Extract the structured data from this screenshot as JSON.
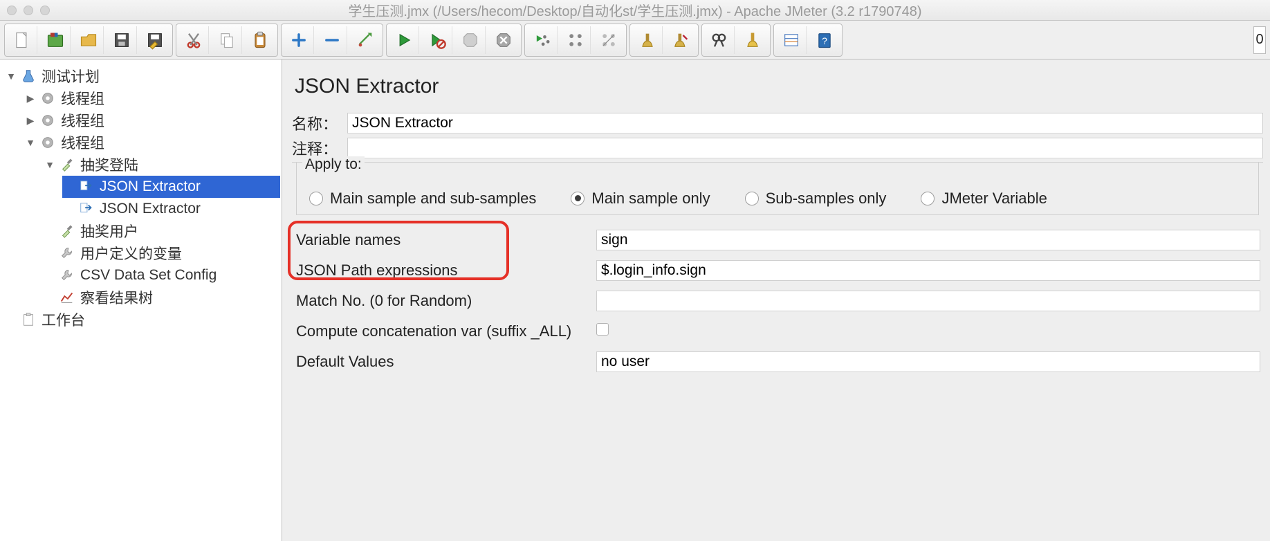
{
  "window": {
    "title": "学生压测.jmx (/Users/hecom/Desktop/自动化st/学生压测.jmx) - Apache JMeter (3.2 r1790748)"
  },
  "tree": {
    "root": "测试计划",
    "thread_1": "线程组",
    "thread_2": "线程组",
    "thread_3": "线程组",
    "lottery_login": "抽奖登陆",
    "json_extractor_1": "JSON Extractor",
    "json_extractor_2": "JSON Extractor",
    "lottery_user": "抽奖用户",
    "user_defined_vars": "用户定义的变量",
    "csv_config": "CSV Data Set Config",
    "view_results_tree": "察看结果树",
    "workbench": "工作台"
  },
  "main": {
    "title": "JSON Extractor",
    "name_label": "名称：",
    "name_value": "JSON Extractor",
    "comments_label": "注释：",
    "comments_value": "",
    "apply_to_label": "Apply to:",
    "apply_options": {
      "main_and_sub": "Main sample and sub-samples",
      "main_only": "Main sample only",
      "sub_only": "Sub-samples only",
      "jmeter_var": "JMeter Variable"
    },
    "apply_selected": "main_only",
    "fields": {
      "variable_names_label": "Variable names",
      "variable_names_value": "sign",
      "json_path_label": "JSON Path expressions",
      "json_path_value": "$.login_info.sign",
      "match_no_label": "Match No. (0 for Random)",
      "match_no_value": "",
      "concat_label": "Compute concatenation var (suffix _ALL)",
      "concat_checked": false,
      "default_values_label": "Default Values",
      "default_values_value": "no user"
    }
  }
}
